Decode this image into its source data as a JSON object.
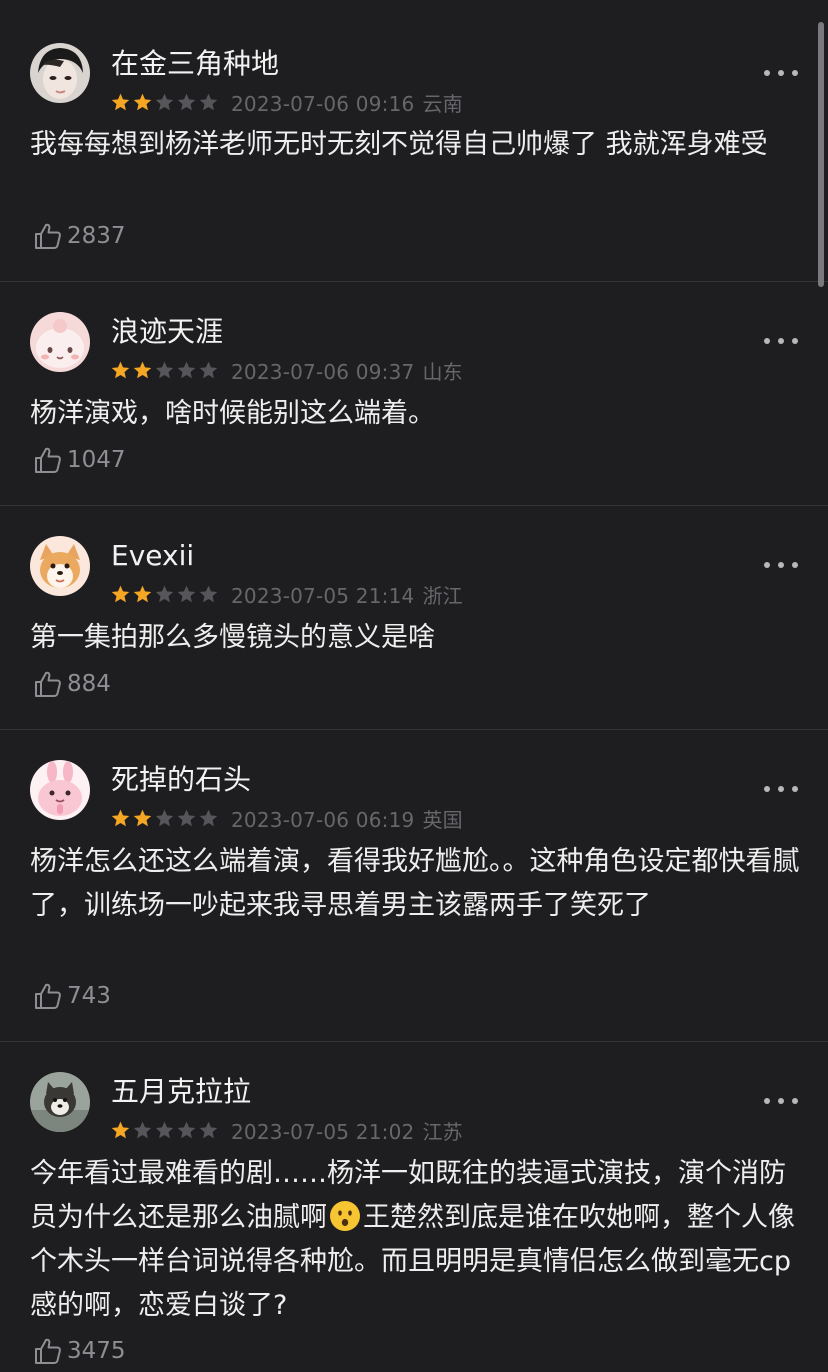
{
  "colors": {
    "background": "#1e1e20",
    "star_filled": "#f5a623",
    "star_empty": "#55555a",
    "meta_text": "#67676b"
  },
  "comments": [
    {
      "username": "在金三角种地",
      "rating": 2,
      "date": "2023-07-06 09:16",
      "location": "云南",
      "text": "我每每想到杨洋老师无时无刻不觉得自己帅爆了 我就浑身难受",
      "likes": "2837"
    },
    {
      "username": "浪迹天涯",
      "rating": 2,
      "date": "2023-07-06 09:37",
      "location": "山东",
      "text": "杨洋演戏，啥时候能别这么端着。",
      "likes": "1047"
    },
    {
      "username": "Evexii",
      "rating": 2,
      "date": "2023-07-05 21:14",
      "location": "浙江",
      "text": "第一集拍那么多慢镜头的意义是啥",
      "likes": "884"
    },
    {
      "username": "死掉的石头",
      "rating": 2,
      "date": "2023-07-06 06:19",
      "location": "英国",
      "text": "杨洋怎么还这么端着演，看得我好尴尬。。这种角色设定都快看腻了，训练场一吵起来我寻思着男主该露两手了笑死了",
      "likes": "743"
    },
    {
      "username": "五月克拉拉",
      "rating": 1,
      "date": "2023-07-05 21:02",
      "location": "江苏",
      "text_before_emoji": "今年看过最难看的剧……杨洋一如既往的装逼式演技，演个消防员为什么还是那么油腻啊",
      "emoji": "frowning-face-emoji",
      "text_after_emoji": "王楚然到底是谁在吹她啊，整个人像个木头一样台词说得各种尬。而且明明是真情侣怎么做到毫无cp感的啊，恋爱白谈了?",
      "likes": "3475"
    }
  ],
  "icons": {
    "more": "ellipsis-icon",
    "like": "thumbs-up-icon",
    "star": "star-icon"
  }
}
